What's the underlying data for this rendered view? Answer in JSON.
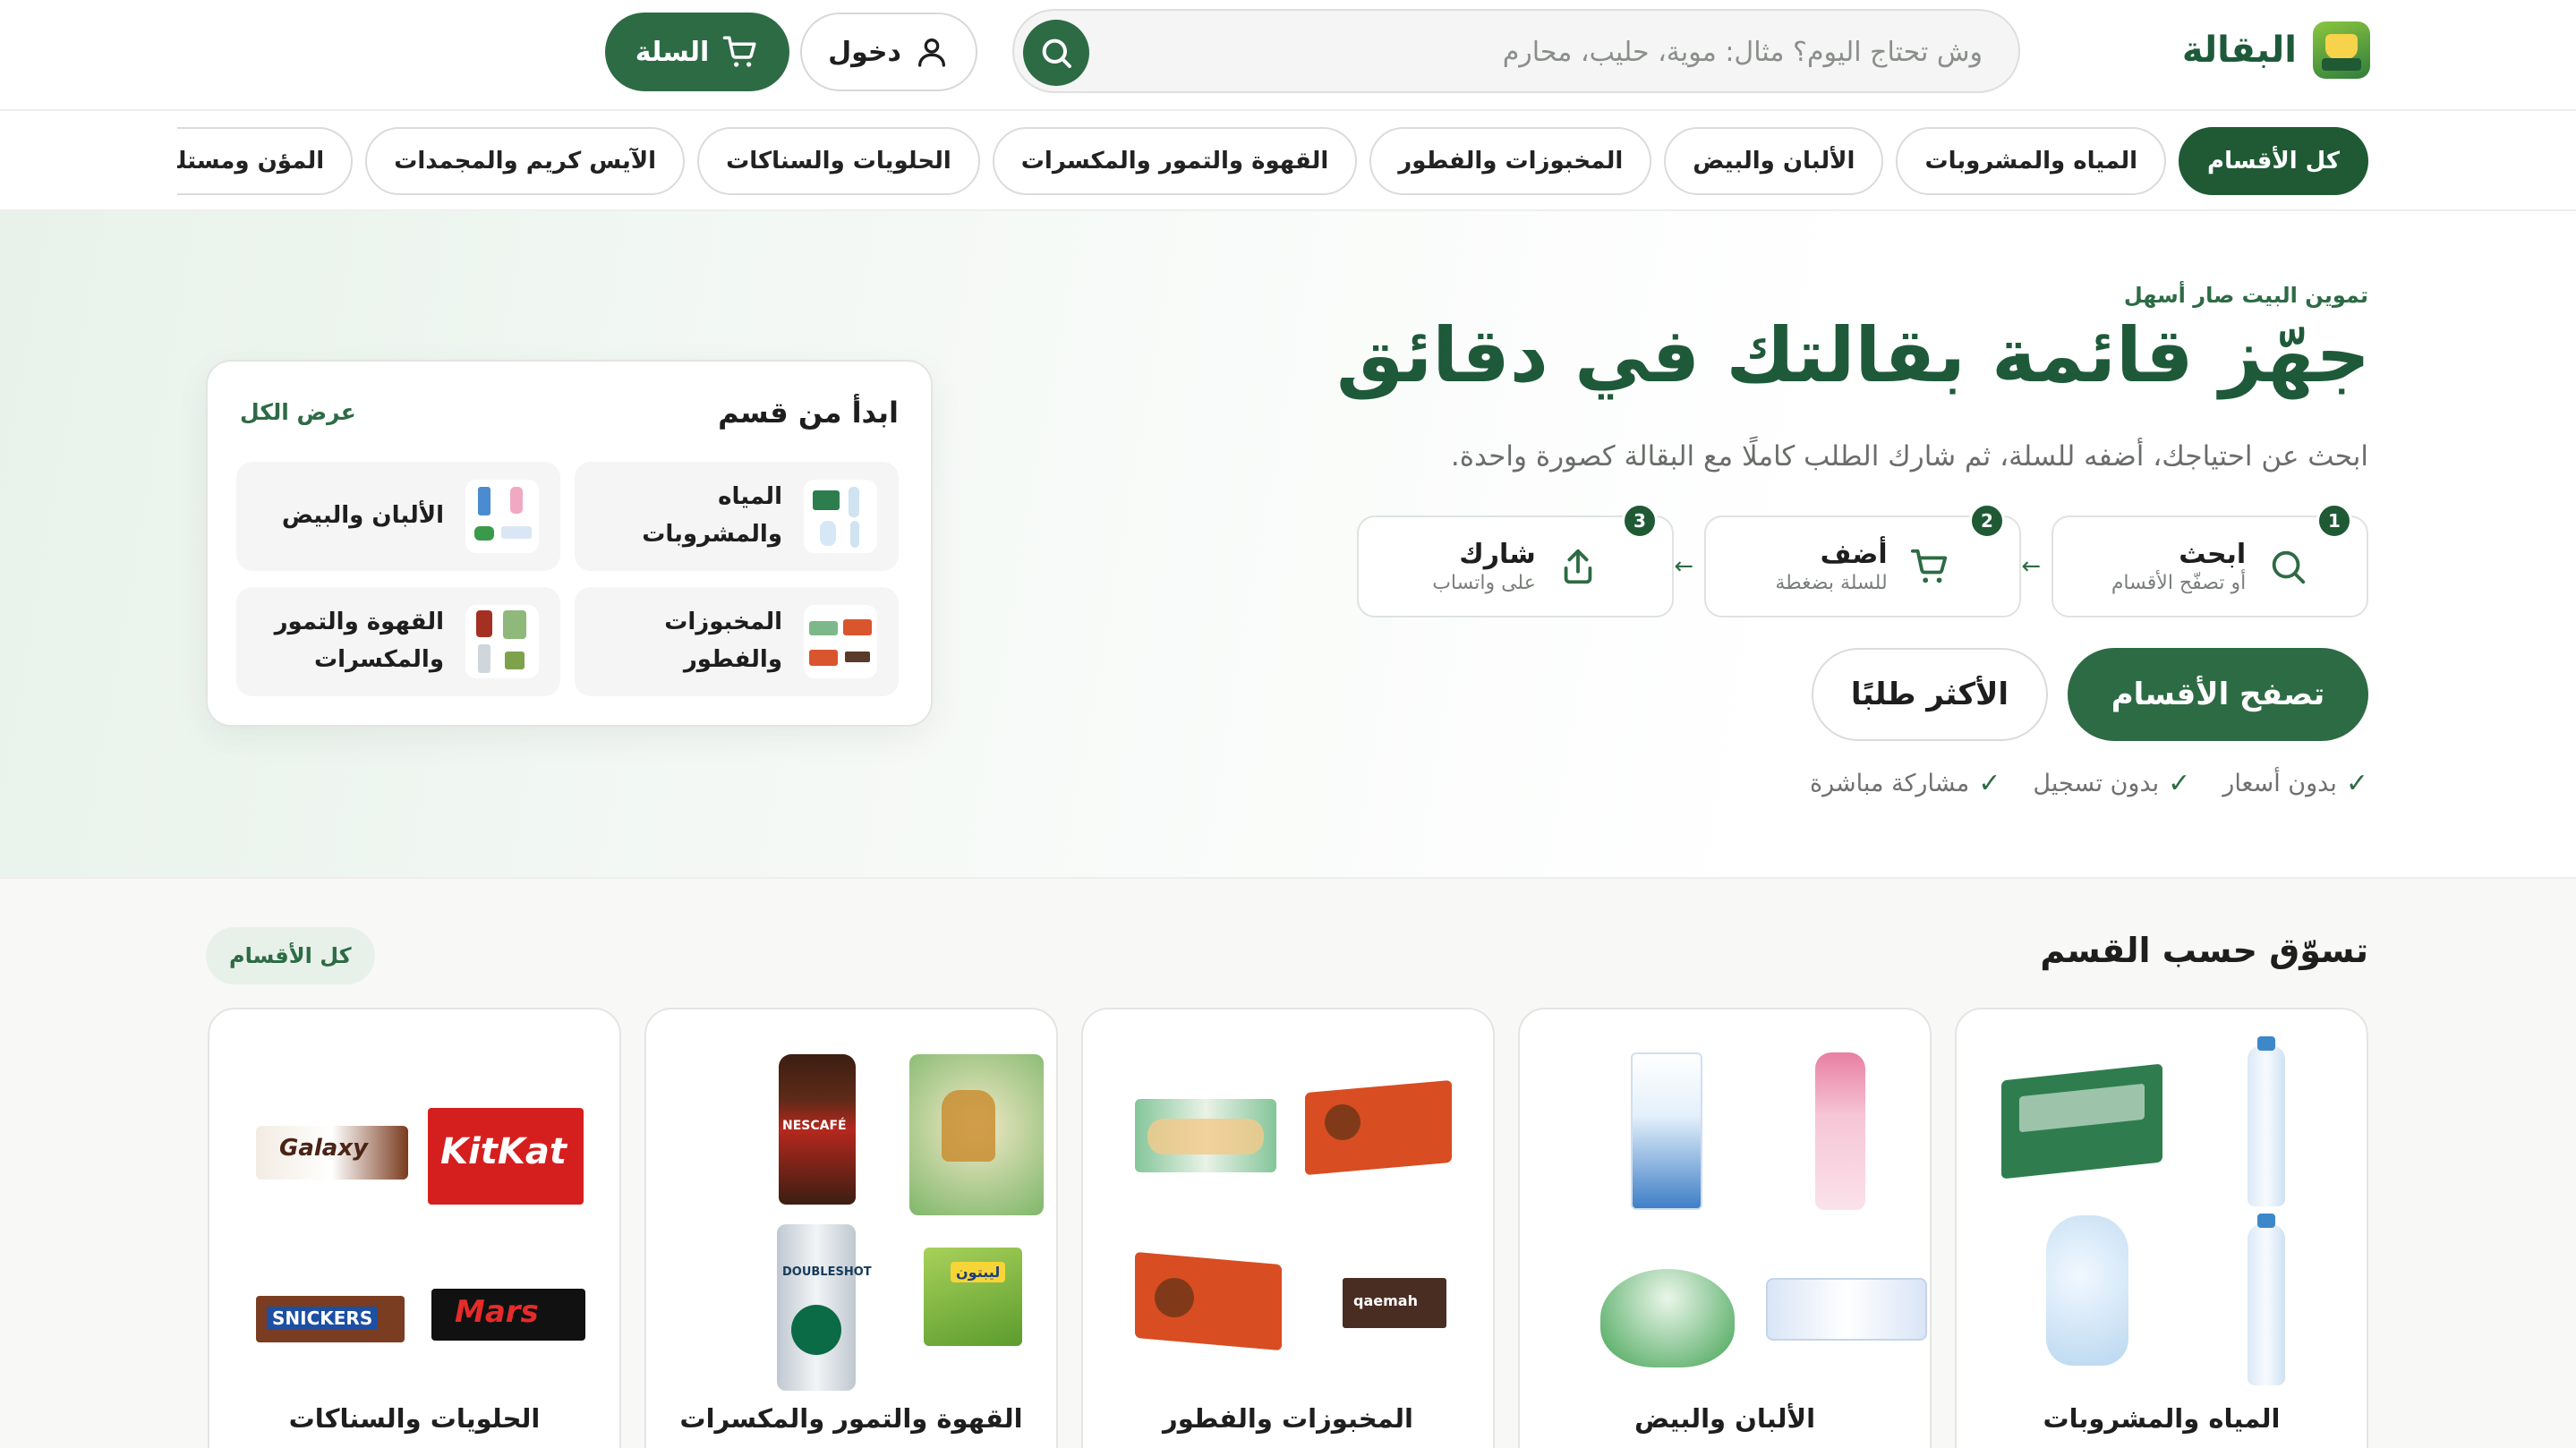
{
  "header": {
    "logo_text": "البقالة",
    "search_placeholder": "وش تحتاج اليوم؟ مثال: موية، حليب، محارم",
    "login_label": "دخول",
    "cart_label": "السلة"
  },
  "category_nav": [
    "كل الأقسام",
    "المياه والمشروبات",
    "الألبان والبيض",
    "المخبوزات والفطور",
    "القهوة والتمور والمكسرات",
    "الحلويات والسناكات",
    "الآيس كريم والمجمدات",
    "المؤن ومستلزمات الد"
  ],
  "hero": {
    "eyebrow": "تموين البيت صار أسهل",
    "title": "جهّز قائمة بقالتك في دقائق",
    "subtitle": "ابحث عن احتياجك، أضفه للسلة، ثم شارك الطلب كاملًا مع البقالة كصورة واحدة.",
    "steps": [
      {
        "number": "1",
        "title": "ابحث",
        "subtitle": "أو تصفّح الأقسام",
        "icon": "search-icon"
      },
      {
        "number": "2",
        "title": "أضف",
        "subtitle": "للسلة بضغطة",
        "icon": "cart-icon"
      },
      {
        "number": "3",
        "title": "شارك",
        "subtitle": "على واتساب",
        "icon": "share-icon"
      }
    ],
    "cta_primary": "تصفح الأقسام",
    "cta_secondary": "الأكثر طلبًا",
    "checks": [
      "بدون أسعار",
      "بدون تسجيل",
      "مشاركة مباشرة"
    ],
    "check_symbol": "✓",
    "step_arrow": "←"
  },
  "start_card": {
    "title": "ابدأ من قسم",
    "view_all": "عرض الكل",
    "items": [
      {
        "label_line1": "المياه",
        "label_line2": "والمشروبات"
      },
      {
        "label_line1": "الألبان والبيض",
        "label_line2": ""
      },
      {
        "label_line1": "المخبوزات",
        "label_line2": "والفطور"
      },
      {
        "label_line1": "القهوة والتمور",
        "label_line2": "والمكسرات"
      }
    ]
  },
  "section": {
    "title": "تسوّق حسب القسم",
    "all_label": "كل الأقسام",
    "cards": [
      {
        "label": "المياه والمشروبات"
      },
      {
        "label": "الألبان والبيض"
      },
      {
        "label": "المخبوزات والفطور"
      },
      {
        "label": "القهوة والتمور والمكسرات"
      },
      {
        "label": "الحلويات والسناكات"
      }
    ]
  },
  "product_text": {
    "nescafe": "NESCAFÉ",
    "lipton": "ليبتون",
    "kitkat": "KitKat",
    "galaxy": "Galaxy",
    "snickers": "SNICKERS",
    "mars": "Mars",
    "doubleshot": "DOUBLESHOT",
    "qaemah": "qaemah"
  },
  "colors": {
    "primary": "#2d6b45",
    "primary_dark": "#1f5a35",
    "title": "#1e5a3a",
    "chip_border": "#d9dcd9"
  }
}
